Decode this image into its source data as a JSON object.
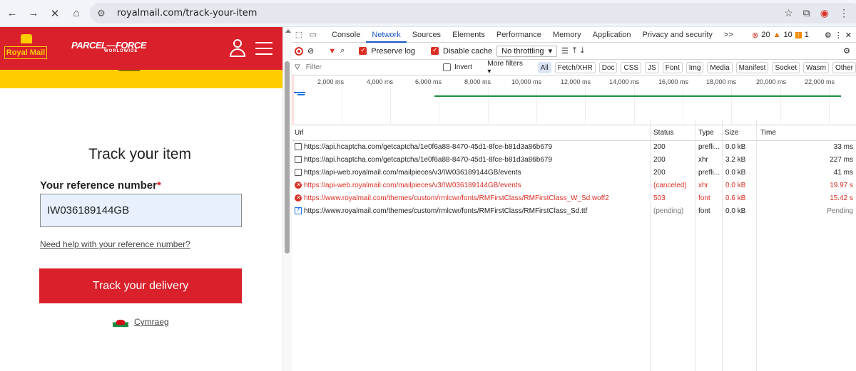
{
  "browser": {
    "url": "royalmail.com/track-your-item"
  },
  "page": {
    "rm_logo": "Royal Mail",
    "pf_logo_main": "PARCEL—FORCE",
    "pf_logo_sub": "WORLDWIDE",
    "title": "Track your item",
    "ref_label": "Your reference number",
    "ref_required": "*",
    "ref_value": "IW036189144GB",
    "help_link": "Need help with your reference number?",
    "track_button": "Track your delivery",
    "language_link": "Cymraeg"
  },
  "devtools": {
    "tabs": [
      "Console",
      "Network",
      "Sources",
      "Elements",
      "Performance",
      "Memory",
      "Application",
      "Privacy and security"
    ],
    "more_tabs": ">>",
    "errors": "20",
    "warnings": "10",
    "info": "1",
    "toolbar": {
      "preserve_log": "Preserve log",
      "disable_cache": "Disable cache",
      "throttling": "No throttling"
    },
    "filter": {
      "placeholder": "Filter",
      "invert": "Invert",
      "more_filters": "More filters",
      "types": [
        "All",
        "Fetch/XHR",
        "Doc",
        "CSS",
        "JS",
        "Font",
        "Img",
        "Media",
        "Manifest",
        "Socket",
        "Wasm",
        "Other"
      ]
    },
    "timeline_ticks": [
      "2,000 ms",
      "4,000 ms",
      "6,000 ms",
      "8,000 ms",
      "10,000 ms",
      "12,000 ms",
      "14,000 ms",
      "16,000 ms",
      "18,000 ms",
      "20,000 ms",
      "22,000 ms"
    ],
    "columns": {
      "url": "Url",
      "status": "Status",
      "type": "Type",
      "size": "Size",
      "time": "Time"
    },
    "rows": [
      {
        "url": "https://api.hcaptcha.com/getcaptcha/1e0f6a88-8470-45d1-8fce-b81d3a86b679",
        "status": "200",
        "type": "prefli...",
        "size": "0.0 kB",
        "time": "33 ms"
      },
      {
        "url": "https://api.hcaptcha.com/getcaptcha/1e0f6a88-8470-45d1-8fce-b81d3a86b679",
        "status": "200",
        "type": "xhr",
        "size": "3.2 kB",
        "time": "227 ms"
      },
      {
        "url": "https://api-web.royalmail.com/mailpieces/v3/IW036189144GB/events",
        "status": "200",
        "type": "prefli...",
        "size": "0.0 kB",
        "time": "41 ms"
      },
      {
        "url": "https://api-web.royalmail.com/mailpieces/v3/IW036189144GB/events",
        "status": "(canceled)",
        "type": "xhr",
        "size": "0.0 kB",
        "time": "19.97 s"
      },
      {
        "url": "https://www.royalmail.com/themes/custom/rmlcwr/fonts/RMFirstClass/RMFirstClass_W_Sd.woff2",
        "status": "503",
        "type": "font",
        "size": "0.6 kB",
        "time": "15.42 s"
      },
      {
        "url": "https://www.royalmail.com/themes/custom/rmlcwr/fonts/RMFirstClass/RMFirstClass_Sd.ttf",
        "status": "(pending)",
        "type": "font",
        "size": "0.0 kB",
        "time": "Pending"
      }
    ]
  }
}
